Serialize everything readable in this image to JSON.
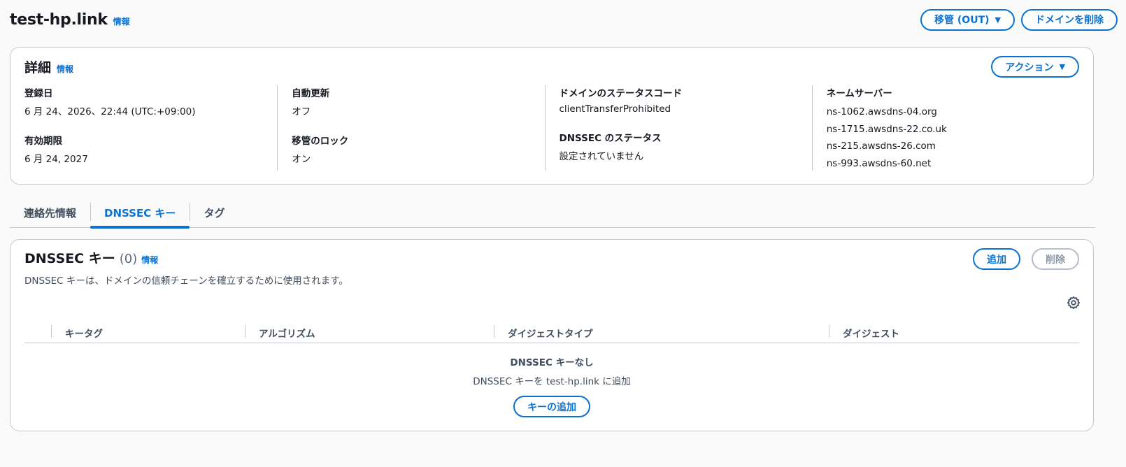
{
  "header": {
    "title": "test-hp.link",
    "info": "情報",
    "transfer_button": "移管 (OUT)",
    "delete_domain_button": "ドメインを削除"
  },
  "details": {
    "title": "詳細",
    "info": "情報",
    "actions_button": "アクション",
    "registered_label": "登録日",
    "registered_value": "6 月 24、2026、22:44 (UTC:+09:00)",
    "expires_label": "有効期限",
    "expires_value": "6 月 24, 2027",
    "auto_renew_label": "自動更新",
    "auto_renew_value": "オフ",
    "transfer_lock_label": "移管のロック",
    "transfer_lock_value": "オン",
    "status_code_label": "ドメインのステータスコード",
    "status_code_value": "clientTransferProhibited",
    "dnssec_status_label": "DNSSEC のステータス",
    "dnssec_status_value": "設定されていません",
    "nameservers_label": "ネームサーバー",
    "nameservers": [
      "ns-1062.awsdns-04.org",
      "ns-1715.awsdns-22.co.uk",
      "ns-215.awsdns-26.com",
      "ns-993.awsdns-60.net"
    ]
  },
  "tabs": [
    {
      "label": "連絡先情報",
      "active": false
    },
    {
      "label": "DNSSEC キー",
      "active": true
    },
    {
      "label": "タグ",
      "active": false
    }
  ],
  "dnssec": {
    "title": "DNSSEC キー",
    "count": "(0)",
    "info": "情報",
    "description": "DNSSEC キーは、ドメインの信頼チェーンを確立するために使用されます。",
    "add_button": "追加",
    "delete_button": "削除",
    "columns": [
      "キータグ",
      "アルゴリズム",
      "ダイジェストタイプ",
      "ダイジェスト"
    ],
    "empty_title": "DNSSEC キーなし",
    "empty_subtitle": "DNSSEC キーを test-hp.link に追加",
    "add_key_button": "キーの追加"
  },
  "colors": {
    "accent": "#0972d3",
    "border": "#c6c6cd",
    "text": "#16191f",
    "disabled": "#8d99a8"
  },
  "icons": {
    "caret": "caret-down-icon",
    "settings": "gear-icon"
  }
}
